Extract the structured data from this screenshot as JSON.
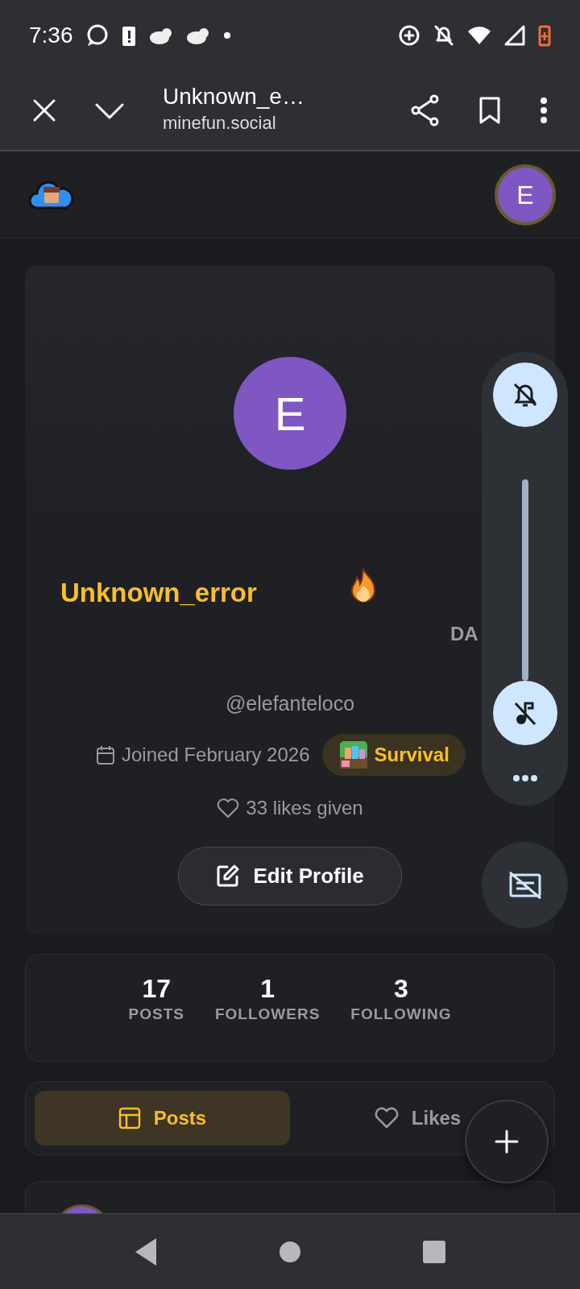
{
  "status_bar": {
    "time": "7:36"
  },
  "browser": {
    "title": "Unknown_e…",
    "url": "minefun.social"
  },
  "site_header": {
    "avatar_letter": "E"
  },
  "profile": {
    "avatar_letter": "E",
    "username": "Unknown_error",
    "streak_label": "DA",
    "handle": "@elefanteloco",
    "joined": "Joined February 2026",
    "mode_badge": "Survival",
    "likes_given": "33 likes given",
    "edit_button": "Edit Profile"
  },
  "stats": [
    {
      "value": "17",
      "label": "POSTS"
    },
    {
      "value": "1",
      "label": "FOLLOWERS"
    },
    {
      "value": "3",
      "label": "FOLLOWING"
    }
  ],
  "tabs": [
    {
      "label": "Posts",
      "selected": true
    },
    {
      "label": "Likes",
      "selected": false
    }
  ]
}
